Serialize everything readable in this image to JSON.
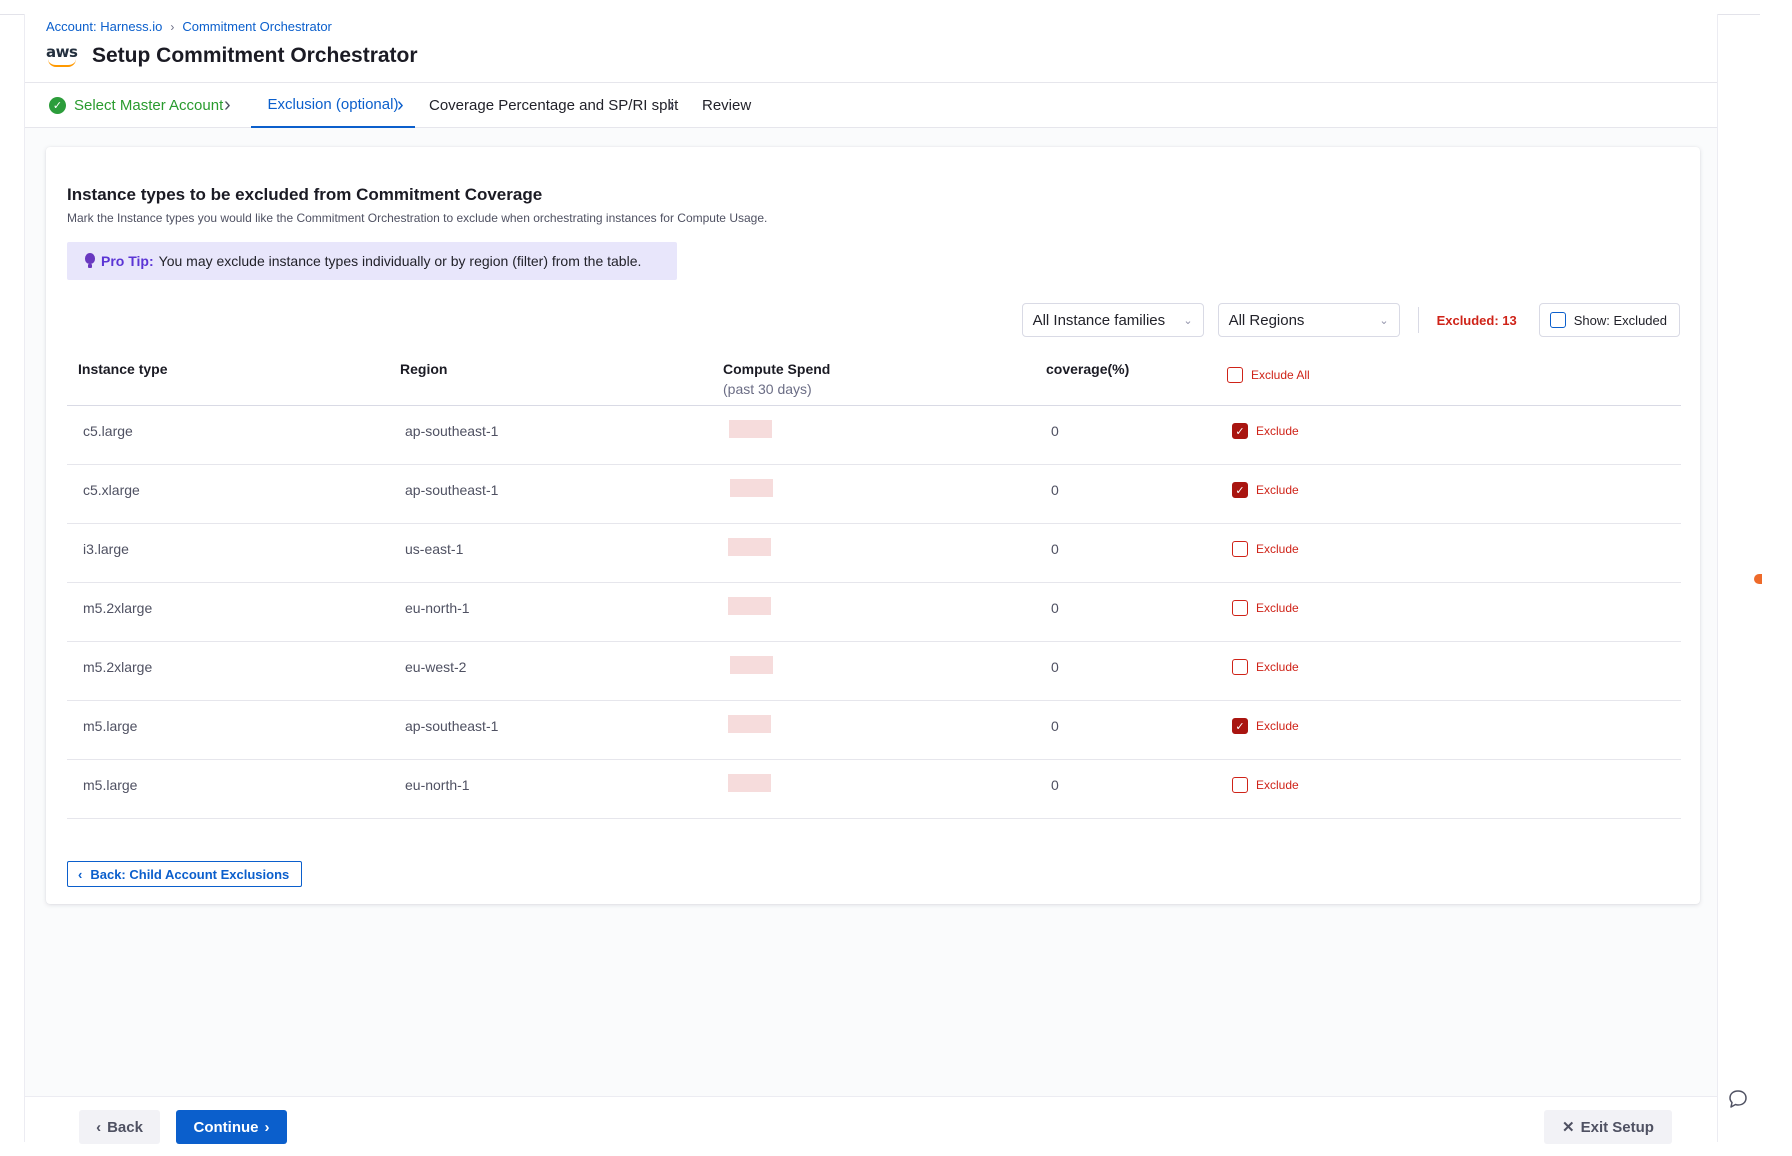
{
  "breadcrumb": {
    "account": "Account: Harness.io",
    "current": "Commitment Orchestrator"
  },
  "header": {
    "logo_text": "aws",
    "title": "Setup Commitment Orchestrator"
  },
  "steps": [
    {
      "label": "Select Master Account",
      "state": "done"
    },
    {
      "label": "Exclusion (optional)",
      "state": "active"
    },
    {
      "label": "Coverage Percentage and SP/RI split",
      "state": "pending"
    },
    {
      "label": "Review",
      "state": "pending"
    }
  ],
  "card": {
    "title": "Instance types to be excluded from Commitment Coverage",
    "subtitle": "Mark the Instance types you would like the Commitment Orchestration to exclude when orchestrating instances for Compute Usage.",
    "protip_label": "Pro Tip:",
    "protip_text": "You may exclude instance types individually or by region (filter) from the table."
  },
  "filters": {
    "instance_families": "All Instance families",
    "regions": "All Regions",
    "excluded_count": "Excluded: 13",
    "show_excluded": "Show: Excluded"
  },
  "table": {
    "columns": {
      "instance_type": "Instance type",
      "region": "Region",
      "compute_spend": "Compute Spend",
      "compute_spend_sub": "(past 30 days)",
      "coverage": "coverage(%)",
      "exclude_all": "Exclude All"
    },
    "exclude_label": "Exclude",
    "rows": [
      {
        "instance_type": "c5.large",
        "region": "ap-southeast-1",
        "coverage": "0",
        "excluded": true
      },
      {
        "instance_type": "c5.xlarge",
        "region": "ap-southeast-1",
        "coverage": "0",
        "excluded": true
      },
      {
        "instance_type": "i3.large",
        "region": "us-east-1",
        "coverage": "0",
        "excluded": false
      },
      {
        "instance_type": "m5.2xlarge",
        "region": "eu-north-1",
        "coverage": "0",
        "excluded": false
      },
      {
        "instance_type": "m5.2xlarge",
        "region": "eu-west-2",
        "coverage": "0",
        "excluded": false
      },
      {
        "instance_type": "m5.large",
        "region": "ap-southeast-1",
        "coverage": "0",
        "excluded": true
      },
      {
        "instance_type": "m5.large",
        "region": "eu-north-1",
        "coverage": "0",
        "excluded": false
      }
    ]
  },
  "back_link": "Back: Child Account Exclusions",
  "footer": {
    "back": "Back",
    "continue": "Continue",
    "exit": "Exit Setup"
  },
  "icons": {
    "step_done": "check-circle-icon",
    "step_separator": "chevron-right-icon",
    "dropdown": "chevron-down-icon",
    "protip": "lightbulb-icon",
    "chat": "chat-bubble-icon"
  },
  "colors": {
    "primary": "#0b5fcc",
    "success": "#299b2e",
    "danger": "#cf2318",
    "tip_bg": "#e8e6fb"
  }
}
